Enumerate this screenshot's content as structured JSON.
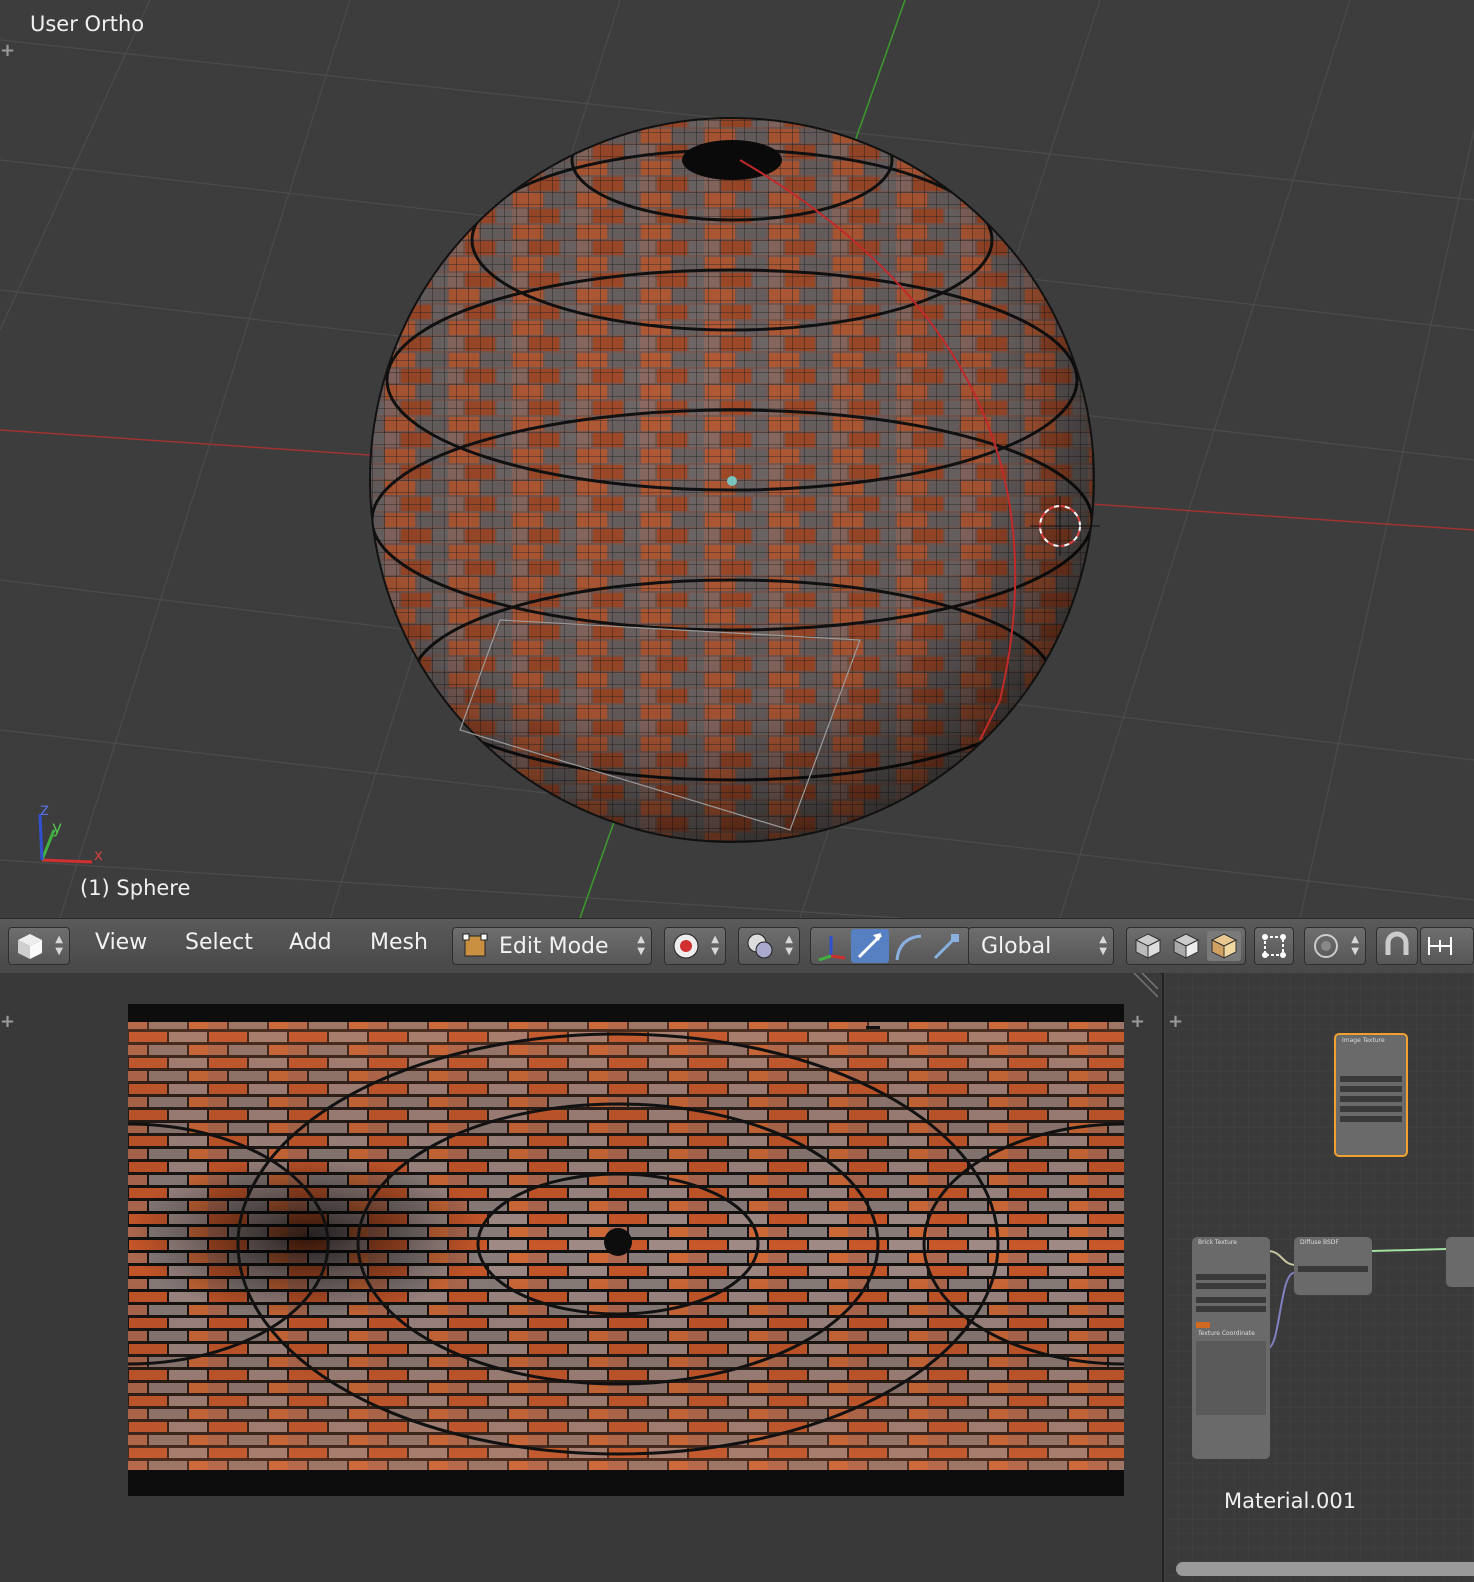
{
  "viewport": {
    "view_label": "User Ortho",
    "object_label": "(1) Sphere",
    "axes": {
      "x": "x",
      "y": "y",
      "z": "z"
    }
  },
  "header": {
    "menu_view": "View",
    "menu_select": "Select",
    "menu_add": "Add",
    "menu_mesh": "Mesh",
    "mode": "Edit Mode",
    "orientation": "Global"
  },
  "node_editor": {
    "material": "Material.001",
    "image_texture_title": "Image Texture",
    "brick_texture_title": "Brick Texture",
    "diffuse_title": "Diffuse BSDF",
    "texcoord_title": "Texture Coordinate"
  },
  "colors": {
    "viewport_bg": "#3d3d3d",
    "brick_orange": "#c8582a",
    "brick_grey": "#8a7c7a",
    "active_node_border": "#f0a030",
    "x_axis": "#c03030",
    "y_axis": "#40a030"
  }
}
